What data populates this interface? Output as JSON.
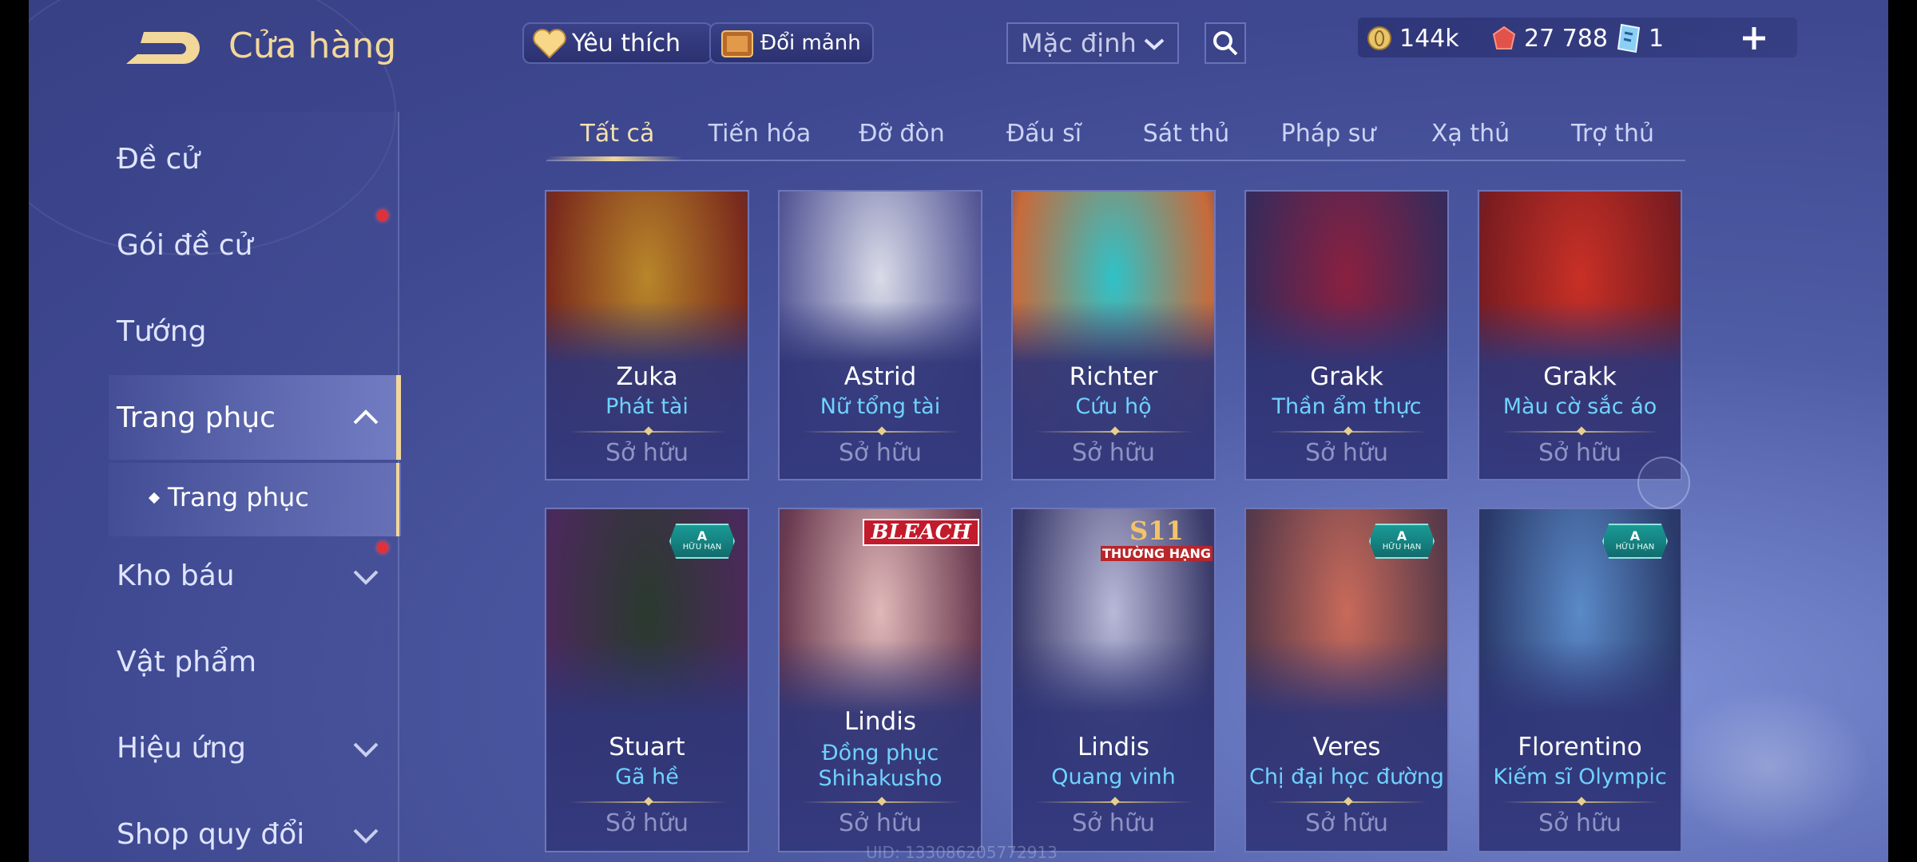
{
  "header": {
    "title": "Cửa hàng",
    "favorite_label": "Yêu thích",
    "shard_label": "Đổi mảnh",
    "sort_selected": "Mặc định"
  },
  "currency": {
    "gold": "144k",
    "ruby": "27 788",
    "voucher": "1"
  },
  "sidebar": {
    "items": [
      {
        "label": "Đề cử"
      },
      {
        "label": "Gói đề cử"
      },
      {
        "label": "Tướng"
      },
      {
        "label": "Trang phục"
      },
      {
        "label": "Kho báu"
      },
      {
        "label": "Vật phẩm"
      },
      {
        "label": "Hiệu ứng"
      },
      {
        "label": "Shop quy đổi"
      }
    ],
    "sub_item": "Trang phục"
  },
  "tabs": [
    "Tất cả",
    "Tiến hóa",
    "Đỡ đòn",
    "Đấu sĩ",
    "Sát thủ",
    "Pháp sư",
    "Xạ thủ",
    "Trợ thủ"
  ],
  "cards": [
    {
      "hero": "Zuka",
      "skin": "Phát tài",
      "status": "Sở hữu",
      "colors": [
        "#b8862a",
        "#7a2a1c"
      ]
    },
    {
      "hero": "Astrid",
      "skin": "Nữ tổng tài",
      "status": "Sở hữu",
      "colors": [
        "#d9dbe8",
        "#5a5c9a"
      ]
    },
    {
      "hero": "Richter",
      "skin": "Cứu hộ",
      "status": "Sở hữu",
      "colors": [
        "#2fc2c8",
        "#c86a3a"
      ]
    },
    {
      "hero": "Grakk",
      "skin": "Thần ẩm thực",
      "status": "Sở hữu",
      "colors": [
        "#8a2040",
        "#3a2a5a"
      ]
    },
    {
      "hero": "Grakk",
      "skin": "Màu cờ sắc áo",
      "status": "Sở hữu",
      "colors": [
        "#c83026",
        "#7a1c20"
      ]
    },
    {
      "hero": "Stuart",
      "skin": "Gã hề",
      "status": "Sở hữu",
      "colors": [
        "#2a3a2e",
        "#4a2a5a"
      ],
      "badge": "limited"
    },
    {
      "hero": "Lindis",
      "skin": "Đồng phục Shihakusho",
      "skin_line1": "Đồng phục",
      "skin_line2": "Shihakusho",
      "status": "Sở hữu",
      "colors": [
        "#e0b8b8",
        "#6a3a50"
      ],
      "badge": "bleach"
    },
    {
      "hero": "Lindis",
      "skin": "Quang vinh",
      "status": "Sở hữu",
      "colors": [
        "#b8b8d8",
        "#3a3a6a"
      ],
      "badge": "s11"
    },
    {
      "hero": "Veres",
      "skin": "Chị đại học đường",
      "status": "Sở hữu",
      "colors": [
        "#c86a5a",
        "#5a3a4a"
      ],
      "badge": "limited"
    },
    {
      "hero": "Florentino",
      "skin": "Kiếm sĩ Olympic",
      "status": "Sở hữu",
      "colors": [
        "#5a8ac8",
        "#2a3a6a"
      ],
      "badge": "limited"
    }
  ],
  "badges": {
    "limited_a": "A",
    "limited_text": "HỮU HẠN",
    "bleach": "BLEACH",
    "s11_big": "S11",
    "s11_small": "THƯỜNG HẠNG"
  },
  "uid": "UID: 133086205772913",
  "icons": {
    "back": "back-arrow-icon",
    "heart": "heart-icon",
    "shard": "shard-chest-icon",
    "search": "search-icon",
    "gold": "gold-coin-icon",
    "ruby": "ruby-icon",
    "voucher": "voucher-icon",
    "plus": "plus-icon"
  },
  "colors": {
    "accent_gold": "#f2d79a",
    "skin_name": "#6fd2ff",
    "notification": "#e0303a"
  }
}
